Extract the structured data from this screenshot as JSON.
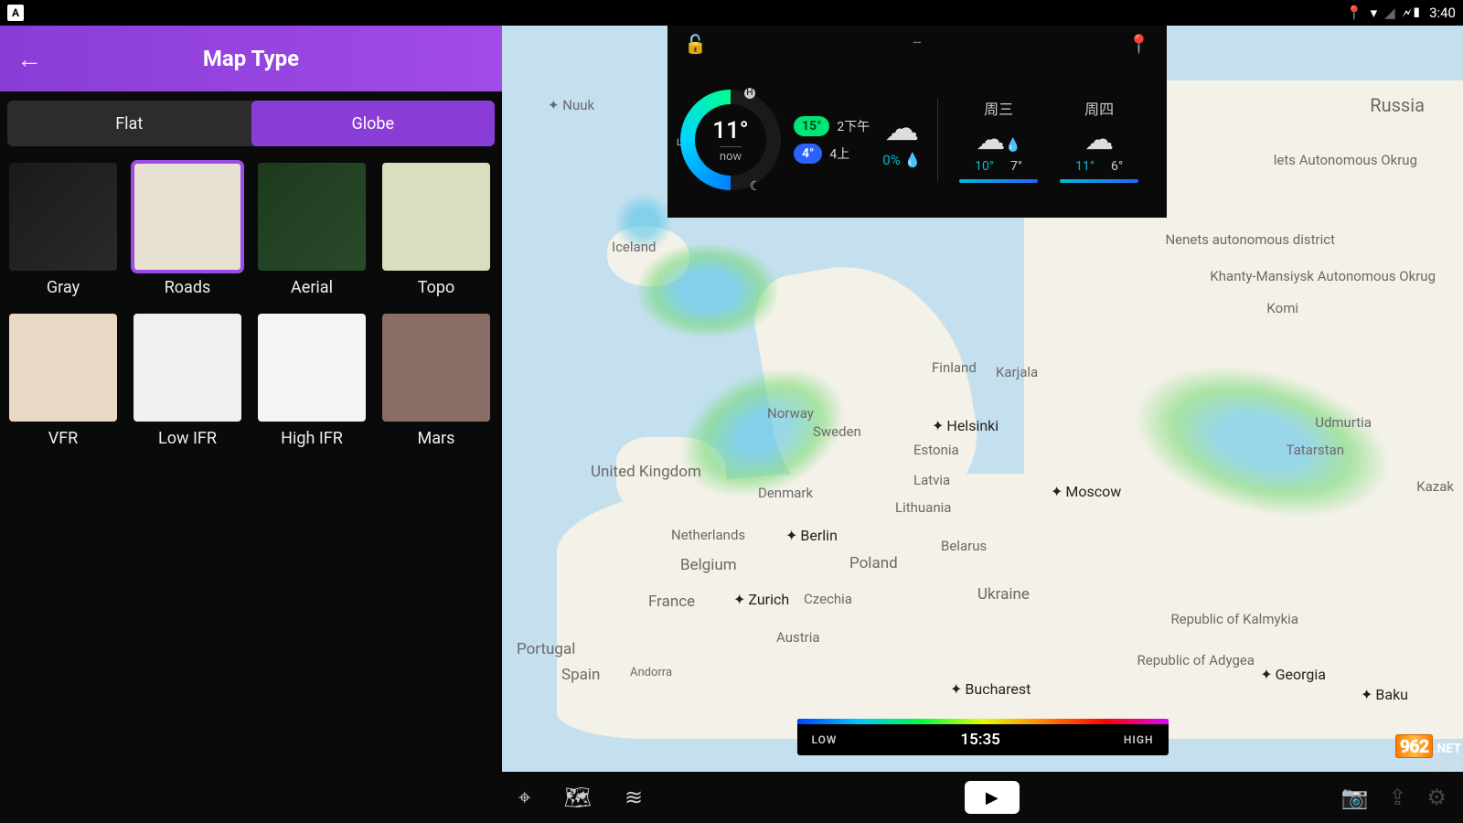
{
  "status_bar": {
    "app_badge": "A",
    "time": "3:40"
  },
  "sidebar": {
    "title": "Map Type",
    "seg": {
      "flat": "Flat",
      "globe": "Globe",
      "active": "globe"
    },
    "tiles": [
      {
        "id": "gray",
        "label": "Gray"
      },
      {
        "id": "roads",
        "label": "Roads",
        "selected": true
      },
      {
        "id": "aerial",
        "label": "Aerial"
      },
      {
        "id": "topo",
        "label": "Topo"
      },
      {
        "id": "vfr",
        "label": "VFR"
      },
      {
        "id": "lowifr",
        "label": "Low IFR"
      },
      {
        "id": "highifr",
        "label": "High IFR"
      },
      {
        "id": "mars",
        "label": "Mars"
      }
    ]
  },
  "weather": {
    "lock_state": "unlocked",
    "location_placeholder": "--",
    "current": {
      "temp": "11°",
      "label": "now",
      "moon": "☾",
      "dial": {
        "L": "L",
        "H": "H"
      }
    },
    "hi": {
      "temp": "15°",
      "when": "2下午"
    },
    "lo": {
      "temp": "4°",
      "when": "4上"
    },
    "today": {
      "precip": "0%",
      "drop": "💧"
    },
    "forecast": [
      {
        "day": "周三",
        "icon": "rain",
        "lo": "10°",
        "hi": "7°"
      },
      {
        "day": "周四",
        "icon": "cloud",
        "lo": "11°",
        "hi": "6°"
      }
    ]
  },
  "map": {
    "labels": {
      "nuuk": "Nuuk",
      "iceland": "Iceland",
      "russia": "Russia",
      "nenets": "Nenets autonomous district",
      "khanty": "Khanty-Mansiysk Autonomous Okrug",
      "komi": "Komi",
      "yamalo": "lets Autonomous Okrug",
      "norway": "Norway",
      "sweden": "Sweden",
      "finland": "Finland",
      "karjala": "Karjala",
      "uk": "United Kingdom",
      "denmark": "Denmark",
      "estonia": "Estonia",
      "latvia": "Latvia",
      "lithuania": "Lithuania",
      "netherlands": "Netherlands",
      "belgium": "Belgium",
      "poland": "Poland",
      "belarus": "Belarus",
      "france": "France",
      "czechia": "Czechia",
      "ukraine": "Ukraine",
      "portugal": "Portugal",
      "spain": "Spain",
      "andorra": "Andorra",
      "austria": "Austria",
      "kalmykia": "Republic of Kalmykia",
      "adygea": "Republic of Adygea",
      "udmurtia": "Udmurtia",
      "tatarstan": "Tatarstan",
      "kazak": "Kazak"
    },
    "markers": {
      "helsinki": "Helsinki",
      "moscow": "Moscow",
      "berlin": "Berlin",
      "zurich": "Zurich",
      "bucharest": "Bucharest",
      "baku": "Baku",
      "georgia": "Georgia"
    }
  },
  "timeline": {
    "low": "LOW",
    "high": "HIGH",
    "time": "15:35"
  },
  "watermark": {
    "logo": "962",
    "net": ".NET",
    "cn": "乐游网"
  }
}
